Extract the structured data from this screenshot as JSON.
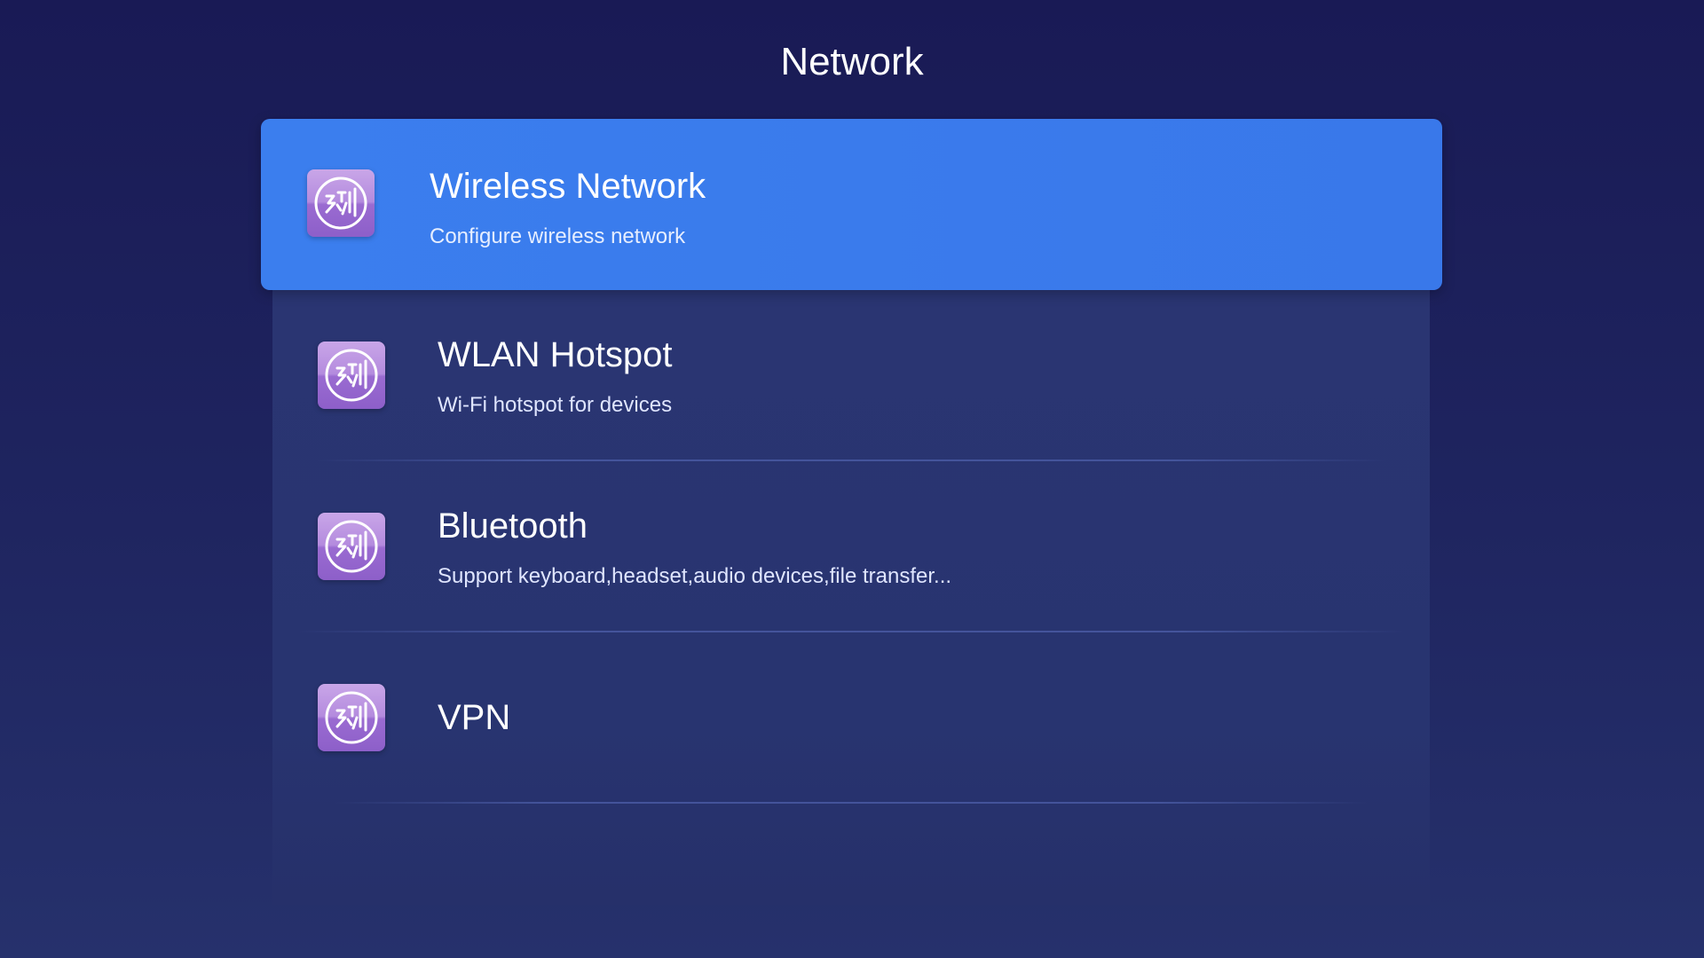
{
  "header": {
    "title": "Network"
  },
  "menu": {
    "items": [
      {
        "title": "Wireless Network",
        "subtitle": "Configure wireless network",
        "icon": "settings-app-icon",
        "focused": true
      },
      {
        "title": "WLAN Hotspot",
        "subtitle": "Wi-Fi hotspot for devices",
        "icon": "settings-app-icon"
      },
      {
        "title": "Bluetooth",
        "subtitle": "Support keyboard,headset,audio devices,file transfer...",
        "icon": "settings-app-icon"
      },
      {
        "title": "VPN",
        "subtitle": "",
        "icon": "settings-app-icon"
      }
    ]
  },
  "colors": {
    "background_top": "#191a55",
    "background_bottom": "#26316c",
    "panel": "#283470",
    "focus_highlight": "#3b7eee",
    "icon_light": "#c9a6e8",
    "icon_dark": "#8d5fc9"
  }
}
